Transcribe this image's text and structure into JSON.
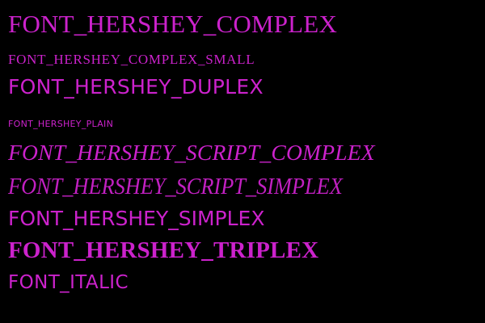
{
  "canvas": {
    "background_color": "#000000",
    "text_color": "#cc22cc"
  },
  "samples": [
    "FONT_HERSHEY_COMPLEX",
    "FONT_HERSHEY_COMPLEX_SMALL",
    "FONT_HERSHEY_DUPLEX",
    "FONT_HERSHEY_PLAIN",
    "FONT_HERSHEY_SCRIPT_COMPLEX",
    "FONT_HERSHEY_SCRIPT_SIMPLEX",
    "FONT_HERSHEY_SIMPLEX",
    "FONT_HERSHEY_TRIPLEX",
    "FONT_ITALIC"
  ]
}
